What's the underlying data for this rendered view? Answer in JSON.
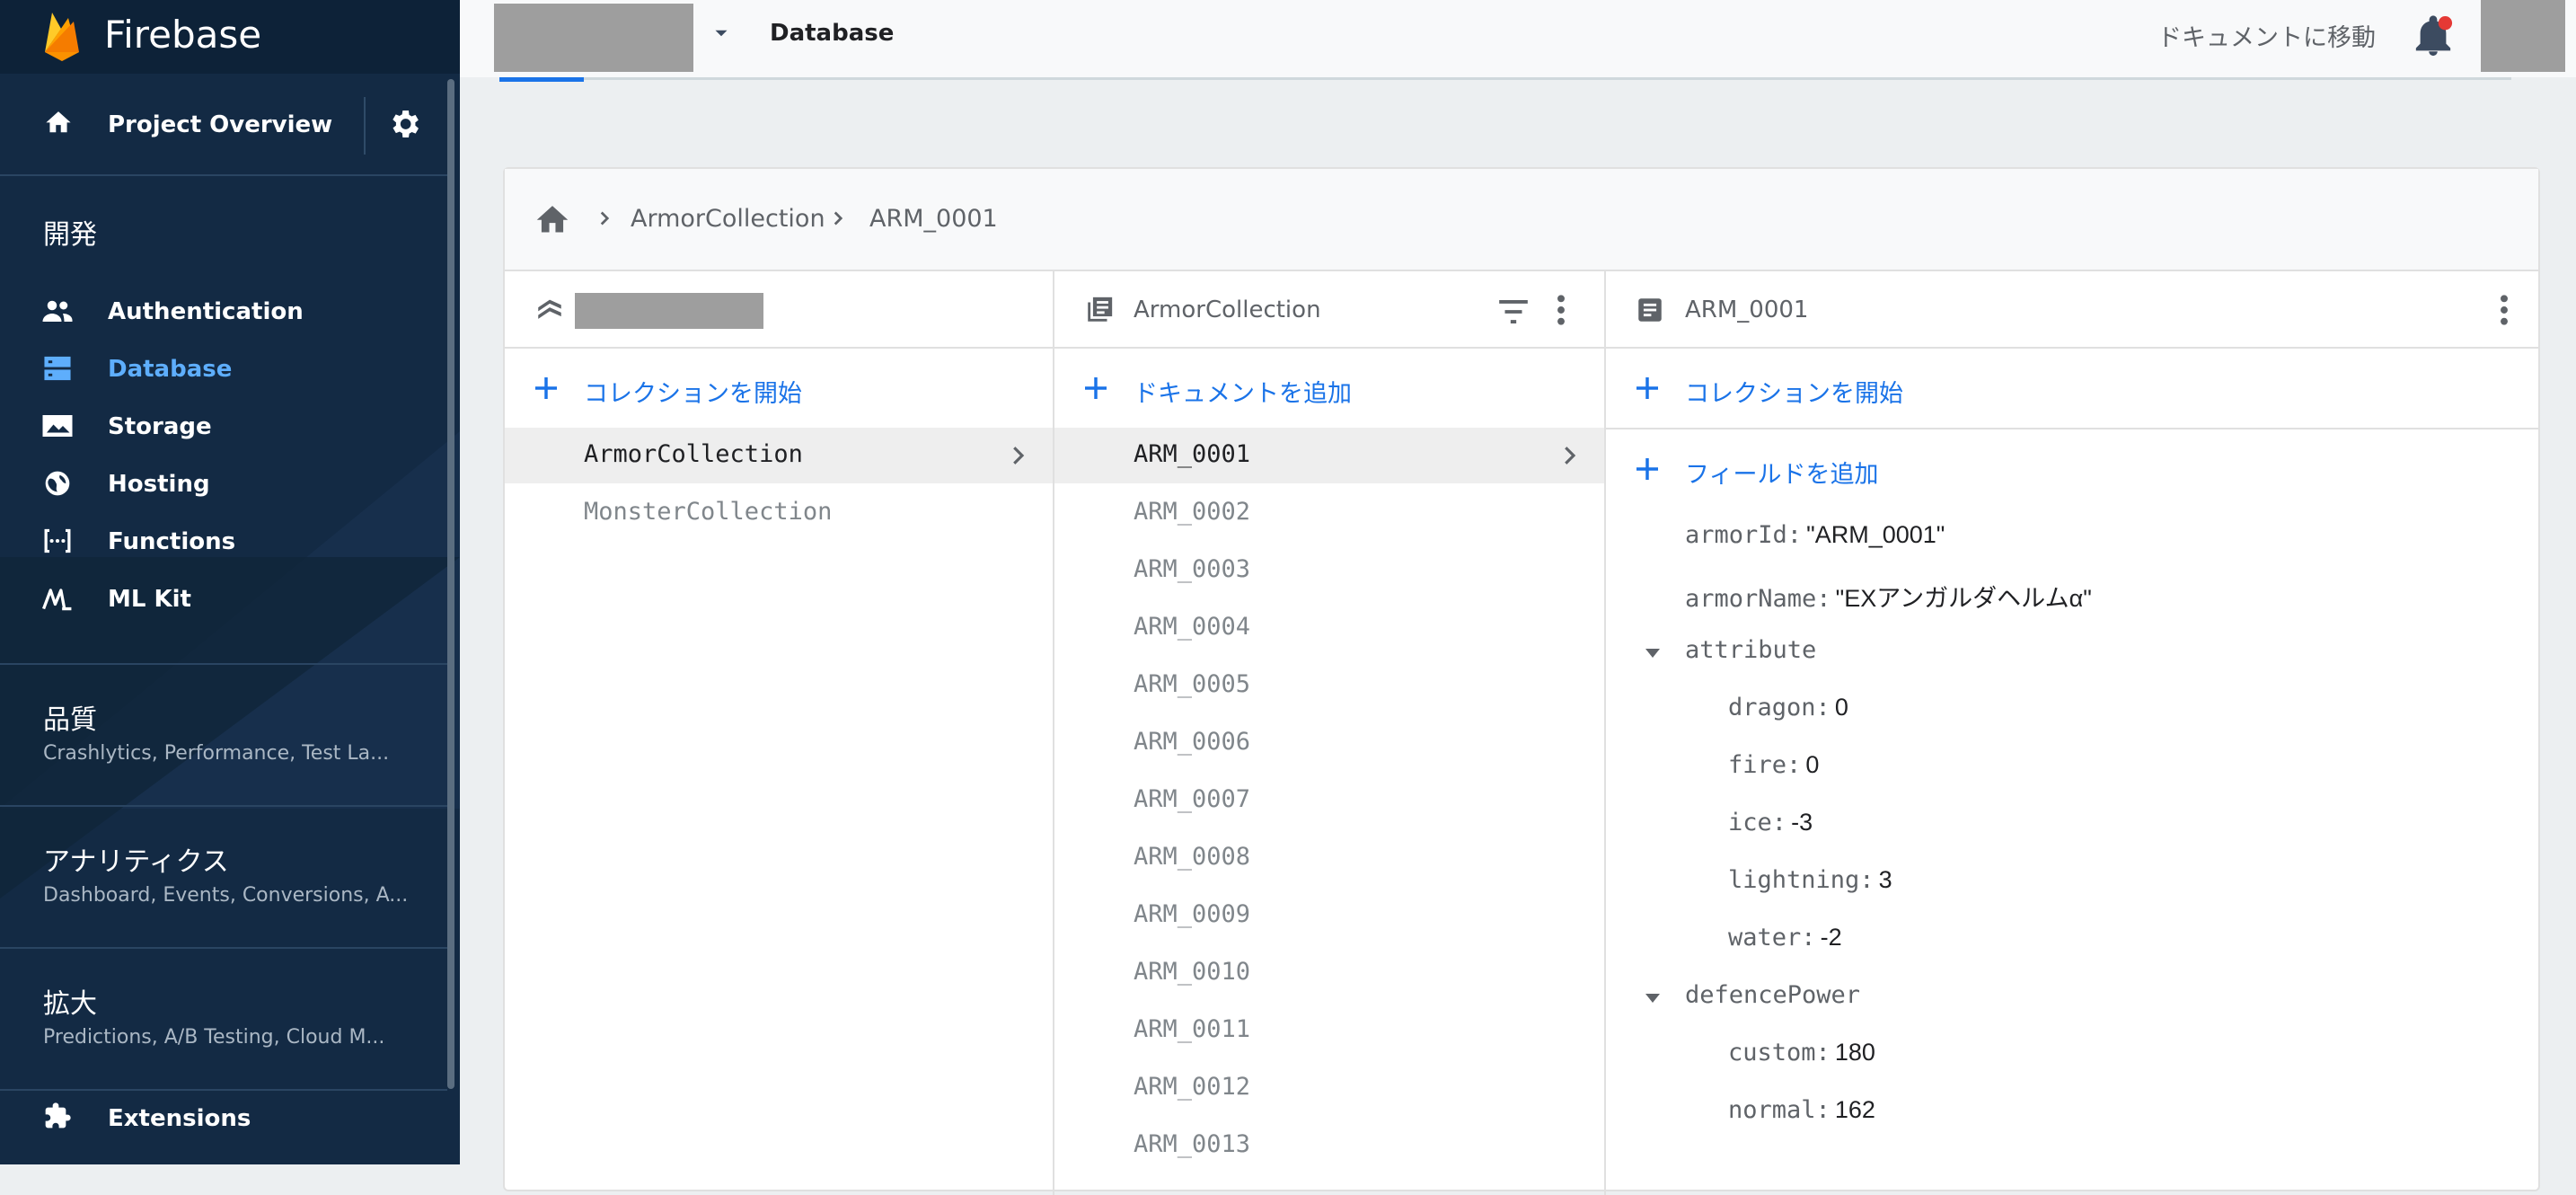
{
  "app": {
    "name": "Firebase"
  },
  "sidebar": {
    "overview_label": "Project Overview",
    "develop_title": "開発",
    "items": [
      {
        "label": "Authentication",
        "icon": "people-icon"
      },
      {
        "label": "Database",
        "icon": "database-icon",
        "active": true
      },
      {
        "label": "Storage",
        "icon": "image-icon"
      },
      {
        "label": "Hosting",
        "icon": "globe-icon"
      },
      {
        "label": "Functions",
        "icon": "functions-icon"
      },
      {
        "label": "ML Kit",
        "icon": "ml-kit-icon"
      }
    ],
    "quality": {
      "title": "品質",
      "sub": "Crashlytics, Performance, Test La..."
    },
    "analytics": {
      "title": "アナリティクス",
      "sub": "Dashboard, Events, Conversions, A..."
    },
    "grow": {
      "title": "拡大",
      "sub": "Predictions, A/B Testing, Cloud M..."
    },
    "extensions_label": "Extensions"
  },
  "topbar": {
    "title": "Database",
    "docs_link": "ドキュメントに移動"
  },
  "breadcrumb": [
    "ArmorCollection",
    "ARM_0001"
  ],
  "col1": {
    "add_label": "コレクションを開始",
    "items": [
      "ArmorCollection",
      "MonsterCollection"
    ]
  },
  "col2": {
    "title": "ArmorCollection",
    "add_label": "ドキュメントを追加",
    "items": [
      "ARM_0001",
      "ARM_0002",
      "ARM_0003",
      "ARM_0004",
      "ARM_0005",
      "ARM_0006",
      "ARM_0007",
      "ARM_0008",
      "ARM_0009",
      "ARM_0010",
      "ARM_0011",
      "ARM_0012",
      "ARM_0013"
    ]
  },
  "col3": {
    "title": "ARM_0001",
    "add_collection_label": "コレクションを開始",
    "add_field_label": "フィールドを追加",
    "fields": [
      {
        "key": "armorId:",
        "value": "\"ARM_0001\""
      },
      {
        "key": "armorName:",
        "value": "\"EXアンガルダヘルムα\""
      },
      {
        "key": "attribute",
        "value": ""
      },
      {
        "key": "dragon:",
        "value": "0"
      },
      {
        "key": "fire:",
        "value": "0"
      },
      {
        "key": "ice:",
        "value": "-3"
      },
      {
        "key": "lightning:",
        "value": "3"
      },
      {
        "key": "water:",
        "value": "-2"
      },
      {
        "key": "defencePower",
        "value": ""
      },
      {
        "key": "custom:",
        "value": "180"
      },
      {
        "key": "normal:",
        "value": "162"
      }
    ]
  },
  "colors": {
    "sidebar": "#132a44",
    "accent": "#1a73e8",
    "active_nav": "#5eaefc"
  }
}
